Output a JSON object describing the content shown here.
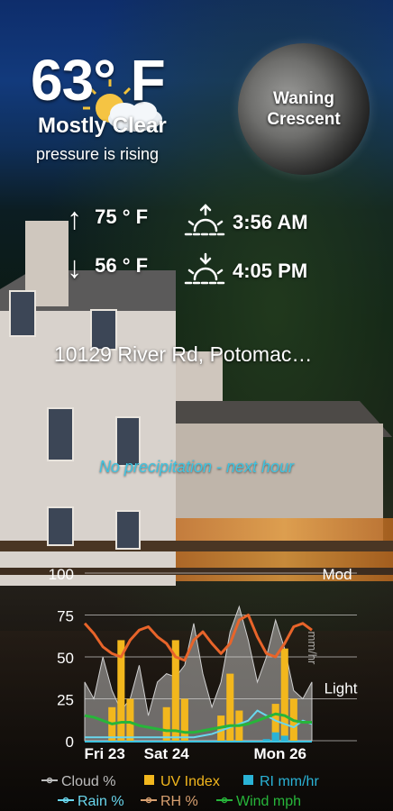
{
  "current": {
    "temperature": "63° F",
    "condition": "Mostly Clear",
    "pressure": "pressure is rising"
  },
  "moon": {
    "phase_line1": "Waning",
    "phase_line2": "Crescent"
  },
  "forecast": {
    "high": "75 ° F",
    "low": "56 ° F",
    "sunrise": "3:56 AM",
    "sunset": "4:05 PM",
    "up_arrow": "↑",
    "down_arrow": "↓"
  },
  "location": {
    "address": "10129 River Rd, Potomac…"
  },
  "precipitation": {
    "message": "No precipitation - next hour"
  },
  "icons": [
    "partly-cloudy-sun-icon",
    "sunrise-icon",
    "sunset-icon"
  ],
  "chart_data": {
    "type": "line",
    "x_tick_labels": [
      "Fri 23",
      "Sat 24",
      "Mon 26"
    ],
    "y_ticks": [
      "100",
      "75",
      "50",
      "25",
      "0"
    ],
    "y_range": [
      0,
      100
    ],
    "right_labels": {
      "top": "Mod",
      "middle": "Light",
      "axis": "mm/hr"
    },
    "grid": true,
    "legend_placement": "bottom",
    "series": [
      {
        "name": "Cloud %",
        "color": "#bdbdbd",
        "values": [
          35,
          25,
          50,
          30,
          18,
          25,
          45,
          15,
          35,
          40,
          38,
          45,
          70,
          40,
          20,
          35,
          65,
          80,
          60,
          35,
          50,
          72,
          55,
          30,
          25,
          35
        ]
      },
      {
        "name": "UV Index",
        "color": "#f2b71d",
        "values": [
          0,
          0,
          0,
          20,
          60,
          25,
          0,
          0,
          0,
          20,
          60,
          25,
          0,
          0,
          0,
          15,
          40,
          18,
          0,
          0,
          0,
          22,
          55,
          25,
          0,
          0
        ]
      },
      {
        "name": "RI mm/hr",
        "color": "#2ab3d6",
        "values": [
          0,
          0,
          0,
          0,
          0,
          0,
          0,
          0,
          0,
          0,
          0,
          0,
          0,
          0,
          0,
          0,
          0,
          0,
          0,
          0,
          1,
          5,
          3,
          0,
          0,
          0
        ]
      },
      {
        "name": "Rain %",
        "color": "#69d7ee",
        "values": [
          2,
          2,
          2,
          2,
          2,
          2,
          2,
          2,
          2,
          2,
          2,
          2,
          2,
          3,
          4,
          6,
          8,
          10,
          12,
          18,
          15,
          12,
          10,
          8,
          12,
          10
        ]
      },
      {
        "name": "RH %",
        "color": "#d8a070",
        "values": [
          70,
          64,
          56,
          52,
          50,
          60,
          66,
          68,
          62,
          58,
          50,
          48,
          60,
          65,
          58,
          52,
          58,
          72,
          75,
          62,
          52,
          50,
          58,
          68,
          70,
          66
        ]
      },
      {
        "name": "Wind mph",
        "color": "#27b53a",
        "values": [
          15,
          14,
          12,
          10,
          11,
          11,
          9,
          8,
          7,
          6,
          6,
          5,
          5,
          6,
          7,
          8,
          9,
          9,
          10,
          12,
          14,
          16,
          15,
          12,
          11,
          11
        ]
      }
    ],
    "legend": [
      {
        "label": "Cloud %",
        "color": "#bdbdbd",
        "marker": "line-dot"
      },
      {
        "label": "UV Index",
        "color": "#f2b71d",
        "marker": "square"
      },
      {
        "label": "RI mm/hr",
        "color": "#2ab3d6",
        "marker": "square"
      },
      {
        "label": "Rain %",
        "color": "#69d7ee",
        "marker": "line-dot"
      },
      {
        "label": "RH %",
        "color": "#d8a070",
        "marker": "line-dot"
      },
      {
        "label": "Wind mph",
        "color": "#27b53a",
        "marker": "line-dot"
      }
    ]
  }
}
